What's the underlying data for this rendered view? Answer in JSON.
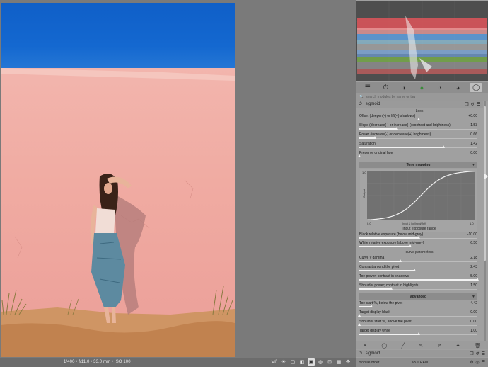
{
  "status_bar": {
    "exif": "1/400 • f/11.0 • 33.0 mm • ISO 100",
    "icons": [
      "vg-icon",
      "bulb-icon",
      "display-icon",
      "clipping-icon",
      "softproof-icon",
      "gamut-icon",
      "focus-icon",
      "grid-icon",
      "guides-icon"
    ],
    "icon_glyphs": [
      "Vő",
      "☀",
      "▢",
      "◧",
      "▣",
      "◍",
      "⊡",
      "▦",
      "✣"
    ]
  },
  "panel": {
    "tabs": [
      "quick-access-icon",
      "base-icon",
      "tone-icon",
      "color-icon",
      "correct-icon",
      "effect-icon",
      "active-icon"
    ],
    "tab_glyphs": [
      "☰",
      "⏻",
      "◑",
      "●",
      "◔",
      "◕",
      "◯"
    ],
    "active_tab": 6,
    "search_placeholder": "search modules by name or tag",
    "module": {
      "name": "sigmoid",
      "section_look": "Look",
      "sliders_look": [
        {
          "label": "Offset (deepen(-) or lift(+) shadows)",
          "value": "+0.00",
          "fraction": 0.5,
          "fill": false
        },
        {
          "label": "Slope (decrease(-) or increase(+) contrast and brightness)",
          "value": "1.53",
          "fraction": 0.32,
          "fill": true
        },
        {
          "label": "Power (increase(-) or decrease(+) brightness)",
          "value": "0.66",
          "fraction": 0.13,
          "fill": true
        },
        {
          "label": "Saturation",
          "value": "1.42",
          "fraction": 0.71,
          "fill": true
        },
        {
          "label": "Preserve original hue",
          "value": "0.00",
          "fraction": 0.0,
          "fill": false
        }
      ],
      "tone_mapping_title": "Tone mapping",
      "graph": {
        "y_label": "Output",
        "y_max": "1.0",
        "x_min": "0.0",
        "x_max": "1.0",
        "axis_caption": "Input & log(Input/Ref)",
        "x_title": "Input exposure range"
      },
      "sliders_exposure": [
        {
          "label": "Black relative exposure (below mid-grey)",
          "value": "-10.00",
          "fraction": 0.5,
          "fill": true
        },
        {
          "label": "White relative exposure (above mid-grey)",
          "value": "6.50",
          "fraction": 0.43,
          "fill": true
        }
      ],
      "curve_params_title": "curve parameters",
      "sliders_curve": [
        {
          "label": "Curve γ gamma",
          "value": "2.18",
          "fraction": 0.35,
          "fill": true
        },
        {
          "label": "Contrast around the pivot",
          "value": "2.43",
          "fraction": 0.47,
          "fill": true
        },
        {
          "label": "Toe power; contrast in shadows",
          "value": "5.00",
          "fraction": 1.0,
          "fill": true
        },
        {
          "label": "Shoulder power; contrast in highlights",
          "value": "1.50",
          "fraction": 0.27,
          "fill": true
        }
      ],
      "advanced_title": "advanced",
      "sliders_advanced": [
        {
          "label": "Toe start %, below the pivot",
          "value": "4.42",
          "fraction": 0.1,
          "fill": true
        },
        {
          "label": "Target display black",
          "value": "0.00",
          "fraction": 0.0,
          "fill": false
        },
        {
          "label": "Shoulder start %, above the pivot",
          "value": "0.00",
          "fraction": 0.0,
          "fill": false
        },
        {
          "label": "Target display white",
          "value": "1.00",
          "fraction": 0.5,
          "fill": true
        }
      ]
    },
    "bottom_icons": [
      "reset-icon",
      "circle-icon",
      "brush-icon",
      "path-icon",
      "eraser-icon",
      "stars-icon",
      "trash-icon"
    ],
    "bottom_glyphs": [
      "✕",
      "◯",
      "╱",
      "✎",
      "✐",
      "✦",
      "🗑"
    ],
    "next_module": "sigmoid",
    "footer": {
      "module_order_label": "module order",
      "module_order_value": "v5.0 RAW"
    }
  },
  "colors": {
    "accent": "#f2f2f2",
    "panel_bg": "#a0a0a0",
    "sky": "#1468d0",
    "wall": "#f0aba2",
    "ground": "#c88a58"
  }
}
